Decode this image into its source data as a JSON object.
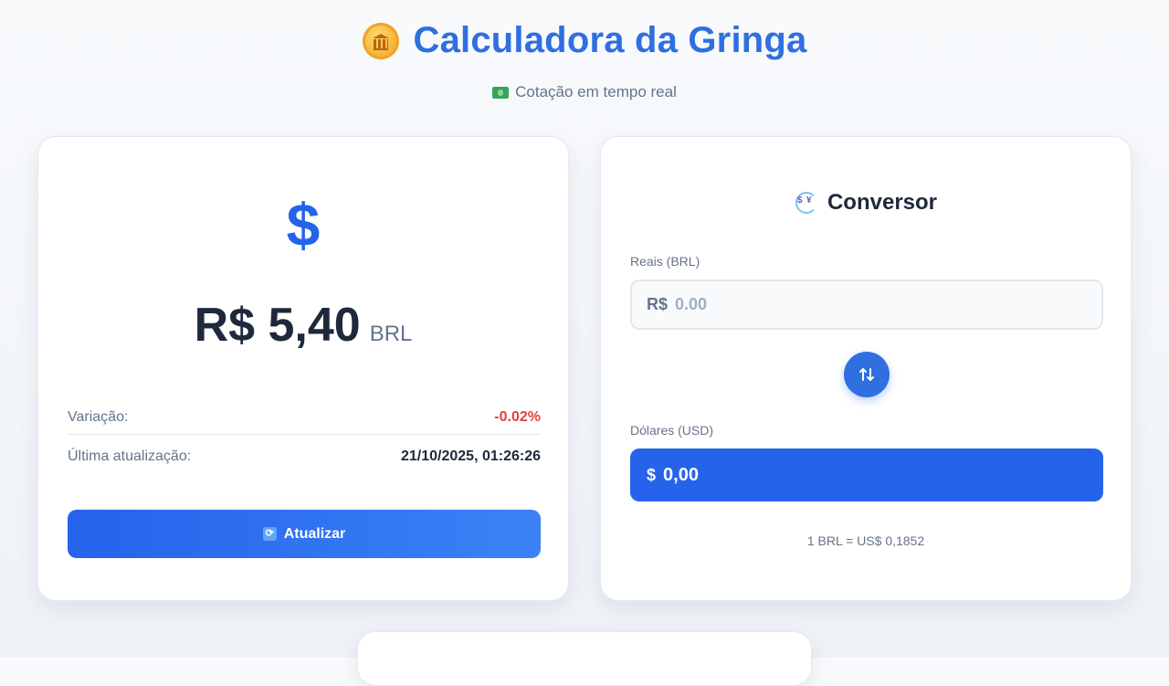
{
  "header": {
    "icon": "bank-coin-icon",
    "title": "Calculadora da Gringa",
    "subtitle_icon": "money-bill-icon",
    "subtitle": "Cotação em tempo real"
  },
  "quote_card": {
    "icon": "$",
    "rate_value": "R$ 5,40",
    "rate_unit": "BRL",
    "variation_label": "Variação:",
    "variation_value": "-0.02%",
    "updated_label": "Última atualização:",
    "updated_value": "21/10/2025, 01:26:26",
    "refresh_button": "Atualizar"
  },
  "converter": {
    "title": "Conversor",
    "brl_label": "Reais (BRL)",
    "brl_prefix": "R$",
    "brl_placeholder": "0.00",
    "usd_label": "Dólares (USD)",
    "usd_prefix": "$",
    "usd_value": "0,00",
    "rate_text": "1 BRL = US$ 0,1852"
  },
  "colors": {
    "accent": "#2563eb",
    "title": "#2f6fe0",
    "negative": "#e53e3e"
  }
}
